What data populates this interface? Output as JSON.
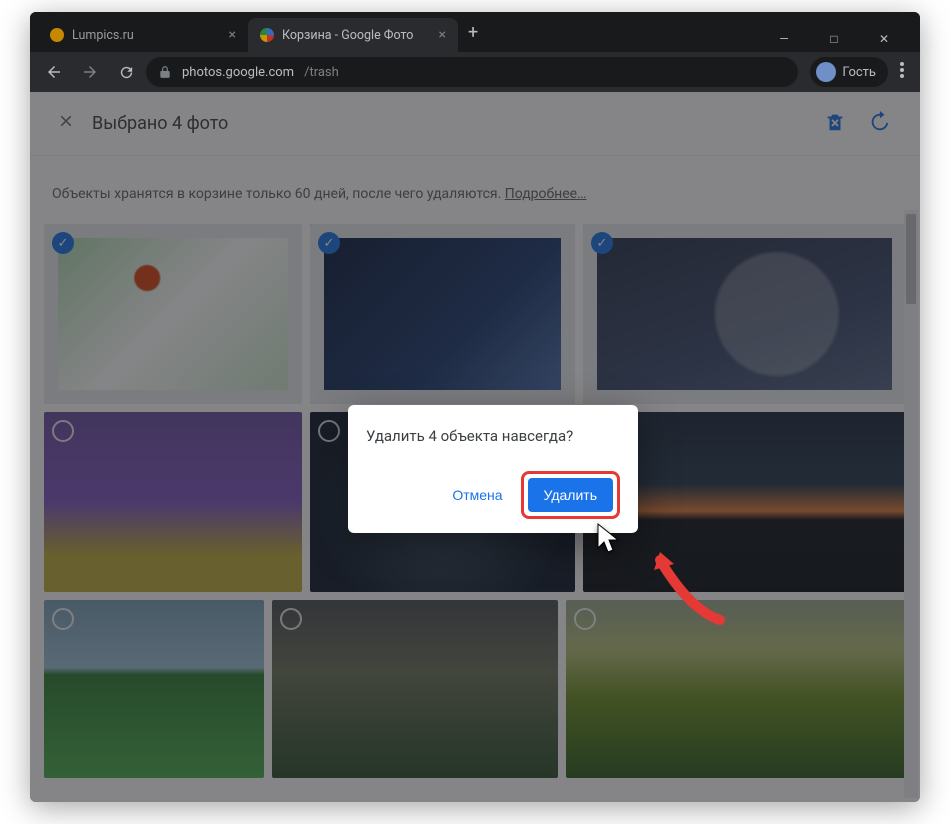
{
  "window": {
    "controls": {
      "minimize": "—",
      "maximize": "□",
      "close": "✕"
    }
  },
  "tabs": [
    {
      "title": "Lumpics.ru",
      "active": false,
      "favicon": "lumpics"
    },
    {
      "title": "Корзина - Google Фото",
      "active": true,
      "favicon": "google-photos"
    }
  ],
  "new_tab_label": "+",
  "toolbar": {
    "url_host": "photos.google.com",
    "url_path": "/trash",
    "profile_label": "Гость"
  },
  "app": {
    "selection_title": "Выбрано 4 фото",
    "info_text": "Объекты хранятся в корзине только 60 дней, после чего удаляются. ",
    "info_link": "Подробнее…",
    "header_icons": {
      "delete_forever": "delete-forever-icon",
      "restore": "restore-icon"
    },
    "photos": [
      {
        "id": "r1a",
        "selected": true,
        "desc": "ladybug on white flowers"
      },
      {
        "id": "r1b",
        "selected": true,
        "desc": "hand touching futuristic screen"
      },
      {
        "id": "r1c",
        "selected": true,
        "desc": "glass globe on laptop keyboard"
      },
      {
        "id": "r2a",
        "selected": false,
        "desc": "yellow crocus flowers"
      },
      {
        "id": "r2b",
        "selected": false,
        "desc": "cpu on motherboard"
      },
      {
        "id": "r2c",
        "selected": false,
        "desc": "boat on lake under orange sky"
      },
      {
        "id": "r3a",
        "selected": false,
        "desc": "lighthouse on green field"
      },
      {
        "id": "r3b",
        "selected": false,
        "desc": "green highlands landscape"
      },
      {
        "id": "r3c",
        "selected": false,
        "desc": "rolling green hills"
      }
    ]
  },
  "dialog": {
    "title": "Удалить 4 объекта навсегда?",
    "cancel_label": "Отмена",
    "confirm_label": "Удалить"
  },
  "annotation": {
    "highlight_target": "delete-confirm-button",
    "pointer": "cursor-arrow"
  }
}
